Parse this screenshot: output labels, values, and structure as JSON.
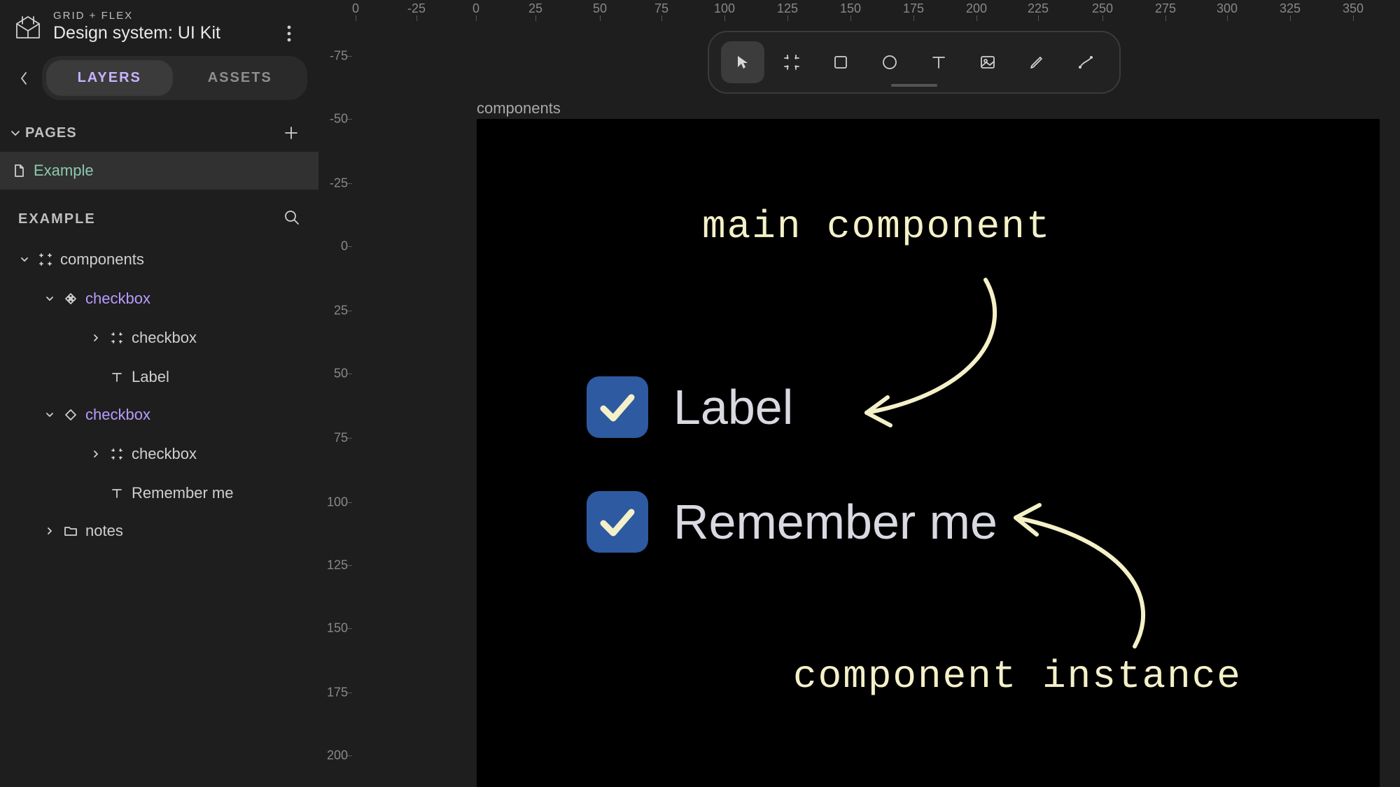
{
  "app": {
    "eyebrow": "GRID + FLEX",
    "title": "Design system: UI Kit"
  },
  "tabs": {
    "layers": "LAYERS",
    "assets": "ASSETS"
  },
  "pages_section": "PAGES",
  "pages": [
    {
      "name": "Example"
    }
  ],
  "layers_header": "EXAMPLE",
  "tree": {
    "components": "components",
    "checkbox1": "checkbox",
    "checkbox1_frame": "checkbox",
    "checkbox1_label": "Label",
    "checkbox2": "checkbox",
    "checkbox2_frame": "checkbox",
    "checkbox2_label": "Remember me",
    "notes": "notes"
  },
  "ruler_h": [
    "0",
    "-25",
    "0",
    "25",
    "50",
    "75",
    "100",
    "125",
    "150",
    "175",
    "200",
    "225",
    "250",
    "275",
    "300",
    "325",
    "350"
  ],
  "ruler_v": [
    "-75",
    "-50",
    "-25",
    "0",
    "25",
    "50",
    "75",
    "100",
    "125",
    "150",
    "175",
    "200"
  ],
  "canvas": {
    "frame_label": "components",
    "ann_main": "main component",
    "ann_instance": "component instance",
    "cbx1_label": "Label",
    "cbx2_label": "Remember me"
  }
}
